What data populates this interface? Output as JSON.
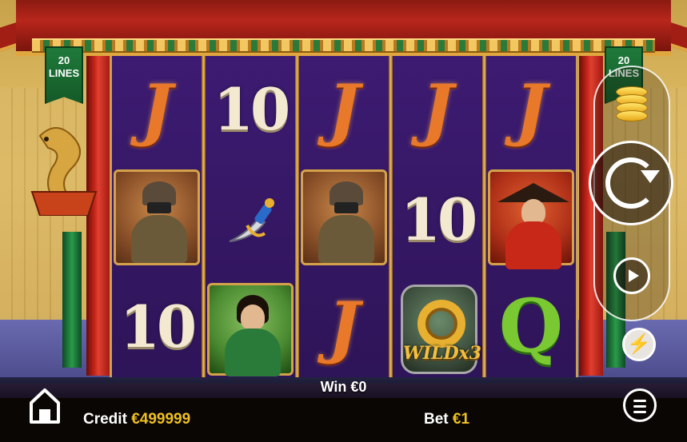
{
  "game": {
    "lines_left": "20\nLINES",
    "lines_right": "20\nLINES",
    "lines_left_num": "20",
    "lines_left_word": "LINES",
    "lines_right_num": "20",
    "lines_right_word": "LINES"
  },
  "reels": [
    [
      "J",
      "warrior",
      "10"
    ],
    [
      "10",
      "dagger",
      "hero"
    ],
    [
      "J",
      "warrior",
      "J"
    ],
    [
      "J",
      "10",
      "wild"
    ],
    [
      "J",
      "lady",
      "Q"
    ]
  ],
  "symbols": {
    "j": "J",
    "ten": "10",
    "q": "Q",
    "wild_text": "WILDx3"
  },
  "status": {
    "win_label": "Win",
    "win_value": "€0",
    "credit_label": "Credit",
    "credit_value": "€499999",
    "bet_label": "Bet",
    "bet_value": "€1"
  },
  "icons": {
    "home": "home-icon",
    "menu": "menu-icon",
    "coins": "coins-icon",
    "spin": "spin-icon",
    "autoplay": "autoplay-icon",
    "turbo": "turbo-icon"
  },
  "colors": {
    "accent_gold": "#f0c020",
    "reel_bg": "#3a1a6a",
    "pillar_red": "#c8261a"
  }
}
